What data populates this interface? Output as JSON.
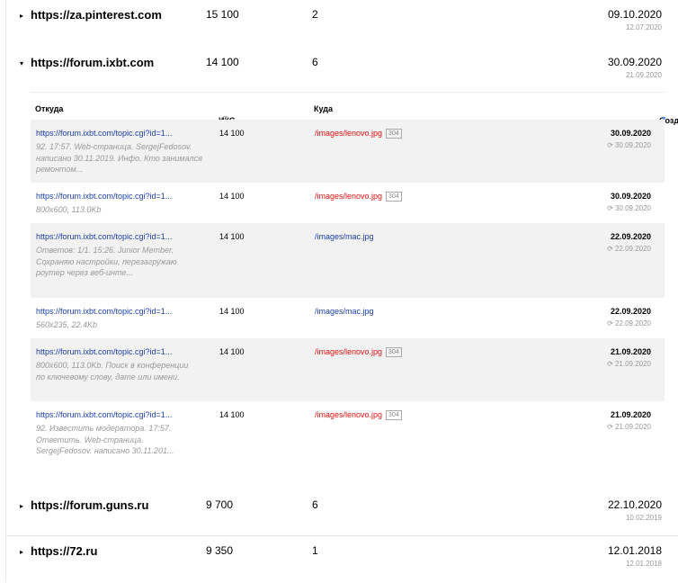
{
  "groups": [
    {
      "site": "https://za.pinterest.com",
      "iks": "15 100",
      "count": "2",
      "date": "09.10.2020",
      "sub": "12.07.2020",
      "arrow": "▸"
    },
    {
      "site": "https://forum.ixbt.com",
      "iks": "14 100",
      "count": "6",
      "date": "30.09.2020",
      "sub": "21.09.2020",
      "arrow": "▾"
    },
    {
      "site": "https://forum.guns.ru",
      "iks": "9 700",
      "count": "6",
      "date": "22.10.2020",
      "sub": "10.02.2019",
      "arrow": "▸"
    },
    {
      "site": "https://72.ru",
      "iks": "9 350",
      "count": "1",
      "date": "12.01.2018",
      "sub": "12.01.2018",
      "arrow": "▸"
    }
  ],
  "inner_header": {
    "from": "Откуда",
    "iks": "ИКС",
    "info_icon": "i",
    "to": "Куда",
    "created": "Создание",
    "sort_icon": "▼"
  },
  "rows": [
    {
      "src": "https://forum.ixbt.com/topic.cgi?id=1...",
      "desc": "92. 17:57. Web-страница. SergejFedosov. написано 30.11.2019. Инфо. Кто занимался ремонтом...",
      "iks": "14 100",
      "dest": "/images/lenovo.jpg",
      "code": "304",
      "date": "30.09.2020",
      "sub": "30.09.2020",
      "refresh_icon": "⟳"
    },
    {
      "src": "https://forum.ixbt.com/topic.cgi?id=1...",
      "desc": "800x600, 113.0Kb",
      "iks": "14 100",
      "dest": "/images/lenovo.jpg",
      "code": "304",
      "date": "30.09.2020",
      "sub": "30.09.2020",
      "refresh_icon": "⟳"
    },
    {
      "src": "https://forum.ixbt.com/topic.cgi?id=1...",
      "desc": "Ответов: 1/1. 15:26. Junior Member. Сохраняю настройки, перезагружаю роутер через веб-инте...",
      "iks": "14 100",
      "dest": "/images/mac.jpg",
      "code": "",
      "date": "22.09.2020",
      "sub": "22.09.2020",
      "refresh_icon": "⟳"
    },
    {
      "src": "https://forum.ixbt.com/topic.cgi?id=1...",
      "desc": "560x235, 22.4Kb",
      "iks": "14 100",
      "dest": "/images/mac.jpg",
      "code": "",
      "date": "22.09.2020",
      "sub": "22.09.2020",
      "refresh_icon": "⟳"
    },
    {
      "src": "https://forum.ixbt.com/topic.cgi?id=1...",
      "desc": "800x600, 113.0Kb. Поиск в конференции по ключевому слову, дате или имени.",
      "iks": "14 100",
      "dest": "/images/lenovo.jpg",
      "code": "304",
      "date": "21.09.2020",
      "sub": "21.09.2020",
      "refresh_icon": "⟳"
    },
    {
      "src": "https://forum.ixbt.com/topic.cgi?id=1...",
      "desc": "92. Известить модератора. 17:57. Ответить. Web-страница. SergejFedosov. написано 30.11.201...",
      "iks": "14 100",
      "dest": "/images/lenovo.jpg",
      "code": "304",
      "date": "21.09.2020",
      "sub": "21.09.2020",
      "refresh_icon": "⟳"
    }
  ],
  "colors": {
    "link": "#1a3fa8",
    "redirect": "#dd1111",
    "muted": "#999999",
    "row_alt": "#f2f2f2"
  }
}
